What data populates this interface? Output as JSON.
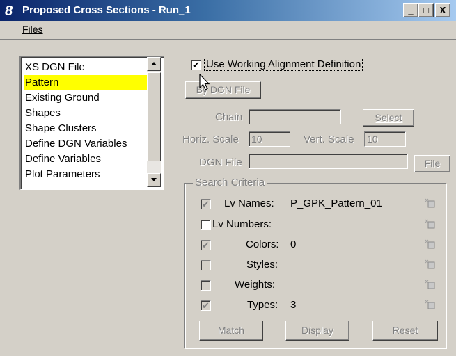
{
  "window": {
    "title": "Proposed Cross Sections - Run_1"
  },
  "titlebar_buttons": {
    "minimize": "_",
    "maximize": "□",
    "close": "X"
  },
  "menu": {
    "files": "Files"
  },
  "sidebar": {
    "items": [
      {
        "label": "XS DGN File"
      },
      {
        "label": "Pattern"
      },
      {
        "label": "Existing Ground"
      },
      {
        "label": "Shapes"
      },
      {
        "label": "Shape Clusters"
      },
      {
        "label": "Define DGN Variables"
      },
      {
        "label": "Define Variables"
      },
      {
        "label": "Plot Parameters"
      }
    ],
    "selected_index": 1,
    "selected_color": "#ffff00"
  },
  "pattern": {
    "use_working_alignment": {
      "label": "Use Working Alignment Definition",
      "checked": true
    },
    "by_dgn_file_button": "By DGN File",
    "chain": {
      "label": "Chain",
      "value": "",
      "select_button": "Select"
    },
    "horiz_scale": {
      "label": "Horiz. Scale",
      "value": "10"
    },
    "vert_scale": {
      "label": "Vert. Scale",
      "value": "10"
    },
    "dgn_file": {
      "label": "DGN File",
      "value": "",
      "file_button": "File"
    }
  },
  "search_criteria": {
    "title": "Search Criteria",
    "rows": [
      {
        "label": "Lv Names:",
        "value": "P_GPK_Pattern_01",
        "checked": true,
        "enabled": false
      },
      {
        "label": "Lv Numbers:",
        "value": "",
        "checked": false,
        "enabled": true
      },
      {
        "label": "Colors:",
        "value": "0",
        "checked": true,
        "enabled": false
      },
      {
        "label": "Styles:",
        "value": "",
        "checked": false,
        "enabled": false
      },
      {
        "label": "Weights:",
        "value": "",
        "checked": false,
        "enabled": false
      },
      {
        "label": "Types:",
        "value": "3",
        "checked": true,
        "enabled": false
      }
    ],
    "buttons": {
      "match": "Match",
      "display": "Display",
      "reset": "Reset"
    }
  },
  "icons": {
    "app": "microstation-logo-icon",
    "pick": "pick-element-icon",
    "cursor": "mouse-cursor-icon"
  },
  "colors": {
    "titlebar_start": "#0a246a",
    "titlebar_end": "#a6caf0",
    "face": "#d4d0c8"
  }
}
